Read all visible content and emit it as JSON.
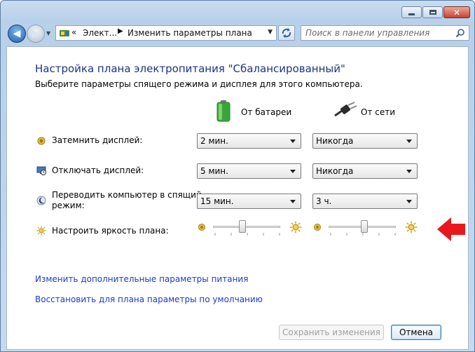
{
  "window": {
    "nav": {
      "address": {
        "chevron": "«",
        "segment1": "Элект...",
        "separator": "▶",
        "segment2": "Изменить параметры плана"
      },
      "search_placeholder": "Поиск в панели управления"
    }
  },
  "page": {
    "title": "Настройка плана электропитания \"Сбалансированный\"",
    "subtitle": "Выберите параметры спящего режима и дисплея для этого компьютера.",
    "columns": {
      "battery": "От батареи",
      "plugged": "От сети"
    },
    "rows": [
      {
        "label": "Затемнить дисплей:",
        "battery": "2 мин.",
        "plugged": "Никогда"
      },
      {
        "label": "Отключать дисплей:",
        "battery": "5 мин.",
        "plugged": "Никогда"
      },
      {
        "label_line1": "Переводить компьютер в спящий",
        "label_line2": "режим:",
        "battery": "15 мин.",
        "plugged": "3 ч."
      }
    ],
    "brightness": {
      "label": "Настроить яркость плана:",
      "battery_level_percent": 43,
      "plugged_level_percent": 53
    },
    "links": {
      "advanced": "Изменить дополнительные параметры питания",
      "restore": "Восстановить для плана параметры по умолчанию"
    },
    "buttons": {
      "save": "Сохранить изменения",
      "cancel": "Отмена"
    }
  },
  "colors": {
    "title": "#1e3287",
    "link": "#1a3dc1",
    "arrow_annotation": "#e8191e"
  },
  "icons": {
    "battery": "battery-icon",
    "plug": "power-plug-icon",
    "dim": "dim-display-icon",
    "display_off": "display-off-icon",
    "sleep": "sleep-icon",
    "brightness": "brightness-icon"
  }
}
